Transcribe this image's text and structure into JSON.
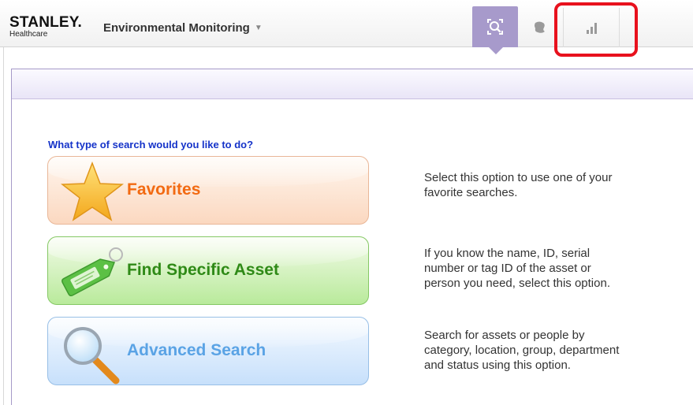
{
  "header": {
    "brand_main": "STANLEY.",
    "brand_sub": "Healthcare",
    "app_title": "Environmental Monitoring",
    "app_caret": "▼"
  },
  "nav": {
    "search_icon": "search-icon",
    "map_icon": "map-icon",
    "reports_icon": "bar-chart-icon",
    "active_color": "#a79acb",
    "highlight_color": "#e8111d"
  },
  "main": {
    "question": "What type of search would you like to do?",
    "options": [
      {
        "label": "Favorites",
        "icon": "star-icon",
        "description_lines": [
          "Select this option to use one of your",
          "favorite searches."
        ]
      },
      {
        "label": "Find Specific Asset",
        "icon": "tag-icon",
        "description_lines": [
          "If you know the name, ID, serial",
          "number or tag ID of the asset or",
          "person you need, select this option."
        ]
      },
      {
        "label": "Advanced Search",
        "icon": "magnifier-icon",
        "description_lines": [
          "Search for assets or people by",
          "category, location, group, department",
          "and status using this option."
        ]
      }
    ]
  }
}
